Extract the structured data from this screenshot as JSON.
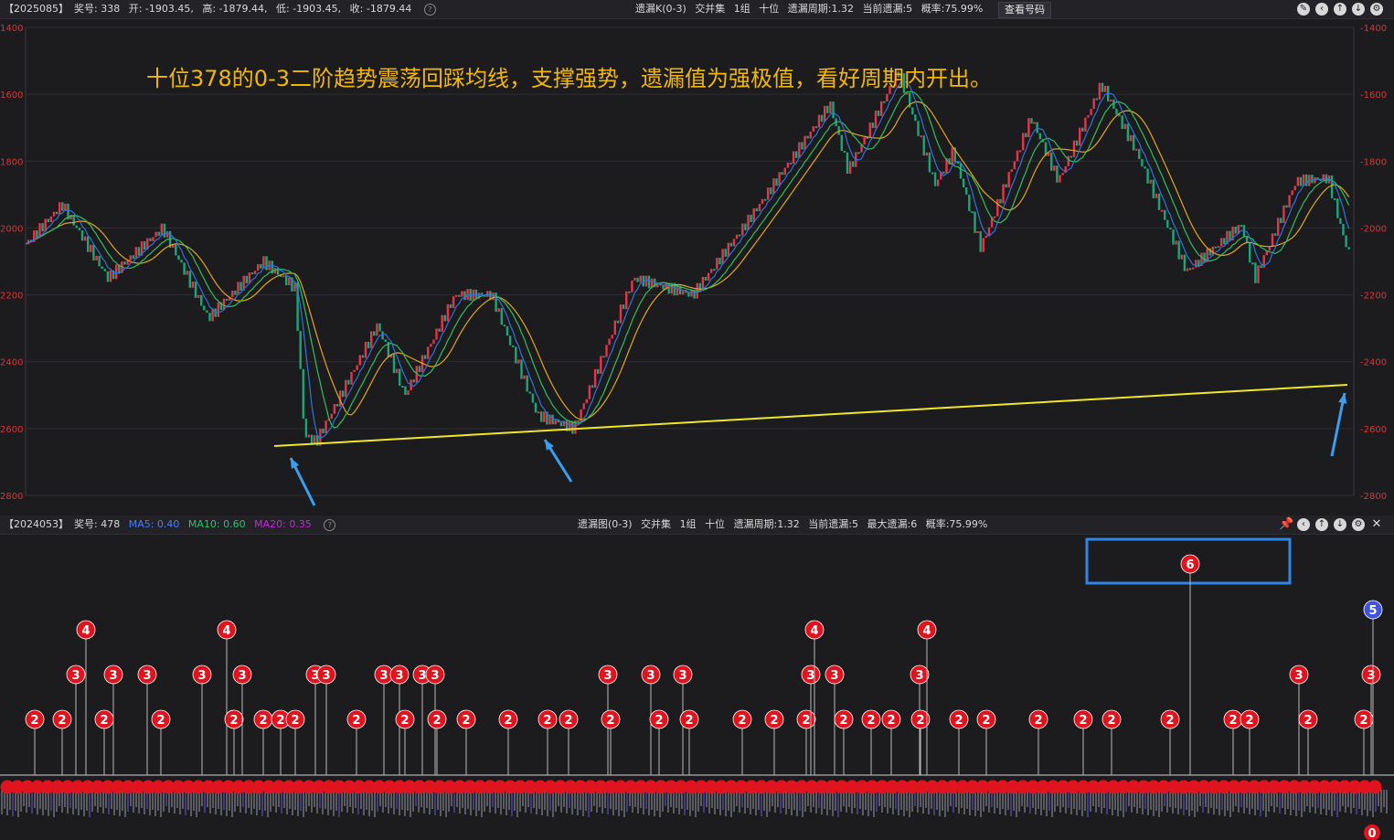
{
  "kline_header": {
    "period": "【2025085】",
    "jianghao": "奖号: 338",
    "open": "开: -1903.45,",
    "high": "高: -1879.44,",
    "low": "低: -1903.45,",
    "close": "收: -1879.44",
    "mid_items": [
      "遗漏K(0-3)",
      "交并集",
      "1组",
      "十位",
      "遗漏周期:1.32",
      "当前遗漏:5",
      "概率:75.99%"
    ],
    "lookup_button": "查看号码"
  },
  "kline_chart": {
    "annotation": "十位378的0-3二阶趋势震荡回踩均线，支撑强势，遗漏值为强极值，看好周期内开出。",
    "y_ticks": [
      -1400,
      -1600,
      -1800,
      -2000,
      -2200,
      -2400,
      -2600,
      -2800
    ],
    "y_labels_left": [
      "1400",
      "1600",
      "1800",
      "2000",
      "2200",
      "2400",
      "2600",
      "2800"
    ],
    "y_labels_right": [
      "-1400",
      "-1600",
      "-1800",
      "-2000",
      "-2200",
      "-2400",
      "-2600",
      "-2800"
    ],
    "colors": {
      "up": "#e8334a",
      "down": "#17a87a",
      "ma5": "#2f73e0",
      "ma10": "#2fbf5f",
      "ma20": "#e3a61c",
      "support": "#f0e62a",
      "arrow": "#3a9ff0"
    }
  },
  "miss_header": {
    "period": "【2024053】",
    "jianghao": "奖号: 478",
    "ma5": "MA5: 0.40",
    "ma10": "MA10: 0.60",
    "ma20": "MA20: 0.35",
    "mid_items": [
      "遗漏图(0-3)",
      "交并集",
      "1组",
      "十位",
      "遗漏周期:1.32",
      "当前遗漏:5",
      "最大遗漏:6",
      "概率:75.99%"
    ]
  },
  "miss_chart": {
    "max_label": "6",
    "current_label": "5",
    "last_zero": "0",
    "colors": {
      "ball": "#e0141e",
      "current_ball": "#3f55e0",
      "highlight_box": "#2e86e6"
    }
  },
  "chart_data": [
    {
      "type": "candlestick",
      "title": "",
      "ylim": [
        -2800,
        -1400
      ],
      "last_candle": {
        "open": -1903.45,
        "high": -1879.44,
        "low": -1903.45,
        "close": -1879.44
      },
      "series": [
        {
          "name": "MA5"
        },
        {
          "name": "MA10"
        },
        {
          "name": "MA20"
        }
      ]
    },
    {
      "type": "bar",
      "title": "",
      "max_value": 6,
      "current_value": 5,
      "ma": {
        "MA5": 0.4,
        "MA10": 0.6,
        "MA20": 0.35
      }
    }
  ]
}
